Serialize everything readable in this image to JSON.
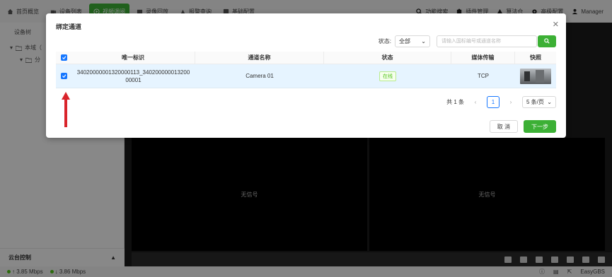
{
  "nav": {
    "items": [
      {
        "label": "首页概览",
        "icon": "home-icon"
      },
      {
        "label": "设备列表",
        "icon": "video-camera-icon"
      },
      {
        "label": "视频调阅",
        "icon": "play-circle-icon"
      },
      {
        "label": "录像回放",
        "icon": "playback-icon"
      },
      {
        "label": "报警查询",
        "icon": "alarm-icon"
      },
      {
        "label": "基础配置",
        "icon": "settings-icon"
      }
    ],
    "right": [
      {
        "label": "功能搜索",
        "icon": "search-icon"
      },
      {
        "label": "插件管理",
        "icon": "puzzle-icon"
      },
      {
        "label": "算法仓",
        "icon": "algorithm-icon"
      },
      {
        "label": "高级配置",
        "icon": "gear-icon"
      },
      {
        "label": "Manager",
        "icon": "user-icon"
      }
    ]
  },
  "sidebar": {
    "title": "设备树",
    "tree": [
      {
        "label": "本域（"
      },
      {
        "label": "分"
      }
    ],
    "ptz_label": "云台控制"
  },
  "video": {
    "no_signal": "无信号"
  },
  "status": {
    "upload": "3.85 Mbps",
    "download": "3.86 Mbps",
    "brand": "EasyGBS"
  },
  "modal": {
    "title": "绑定通道",
    "filter_label": "状态:",
    "filter_value": "全部",
    "search_placeholder": "请输入国标编号或通道名称",
    "columns": [
      "唯一标识",
      "通道名称",
      "状态",
      "媒体传输",
      "快照"
    ],
    "rows": [
      {
        "id": "34020000001320000113_34020000001320000001",
        "name": "Camera 01",
        "status": "在线",
        "transport": "TCP",
        "checked": true
      }
    ],
    "pager": {
      "total": "共 1 条",
      "current": "1",
      "page_size": "5 条/页"
    },
    "cancel_label": "取 消",
    "next_label": "下一步"
  },
  "colors": {
    "accent": "#3cb035",
    "primary_blue": "#1677ff",
    "arrow": "#d9242b"
  }
}
